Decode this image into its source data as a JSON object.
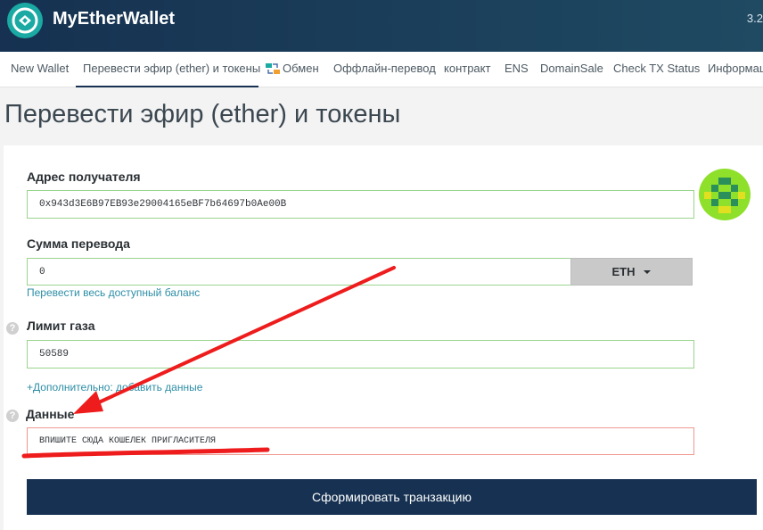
{
  "header": {
    "brand": "MyEtherWallet",
    "version": "3.2"
  },
  "nav": {
    "items": [
      {
        "label": "New Wallet"
      },
      {
        "label": "Перевести эфир (ether) и токены"
      },
      {
        "label": "Обмен"
      },
      {
        "label": "Оффлайн-перевод"
      },
      {
        "label": "контракт"
      },
      {
        "label": "ENS"
      },
      {
        "label": "DomainSale"
      },
      {
        "label": "Check TX Status"
      },
      {
        "label": "Информац"
      }
    ],
    "active_index": 1
  },
  "page": {
    "title": "Перевести эфир (ether) и токены"
  },
  "form": {
    "recipient_label": "Адрес получателя",
    "recipient_value": "0x943d3E6B97EB93e29004165eBF7b64697b0Ae00B",
    "amount_label": "Сумма перевода",
    "amount_value": "0",
    "currency": "ETH",
    "send_all_link": "Перевести весь доступный баланс",
    "gas_label": "Лимит газа",
    "gas_value": "50589",
    "advanced_link": "+Дополнительно: добавить данные",
    "data_label": "Данные",
    "data_value": "ВПИШИТЕ СЮДА КОШЕЛЕК ПРИГЛАСИТЕЛЯ",
    "submit_label": "Сформировать транзакцию",
    "help_glyph": "?"
  },
  "icons": {
    "logo": "mew-logo-icon",
    "swap": "swap-icon",
    "currency_caret": "caret-down-icon",
    "identicon": "address-identicon"
  },
  "colors": {
    "header_bg": "#163151",
    "accent": "#1aa9a3",
    "valid_border": "#9ad58e",
    "invalid_border": "#f0988f",
    "link": "#2d8ea6",
    "annotation": "#ee1c1c"
  }
}
